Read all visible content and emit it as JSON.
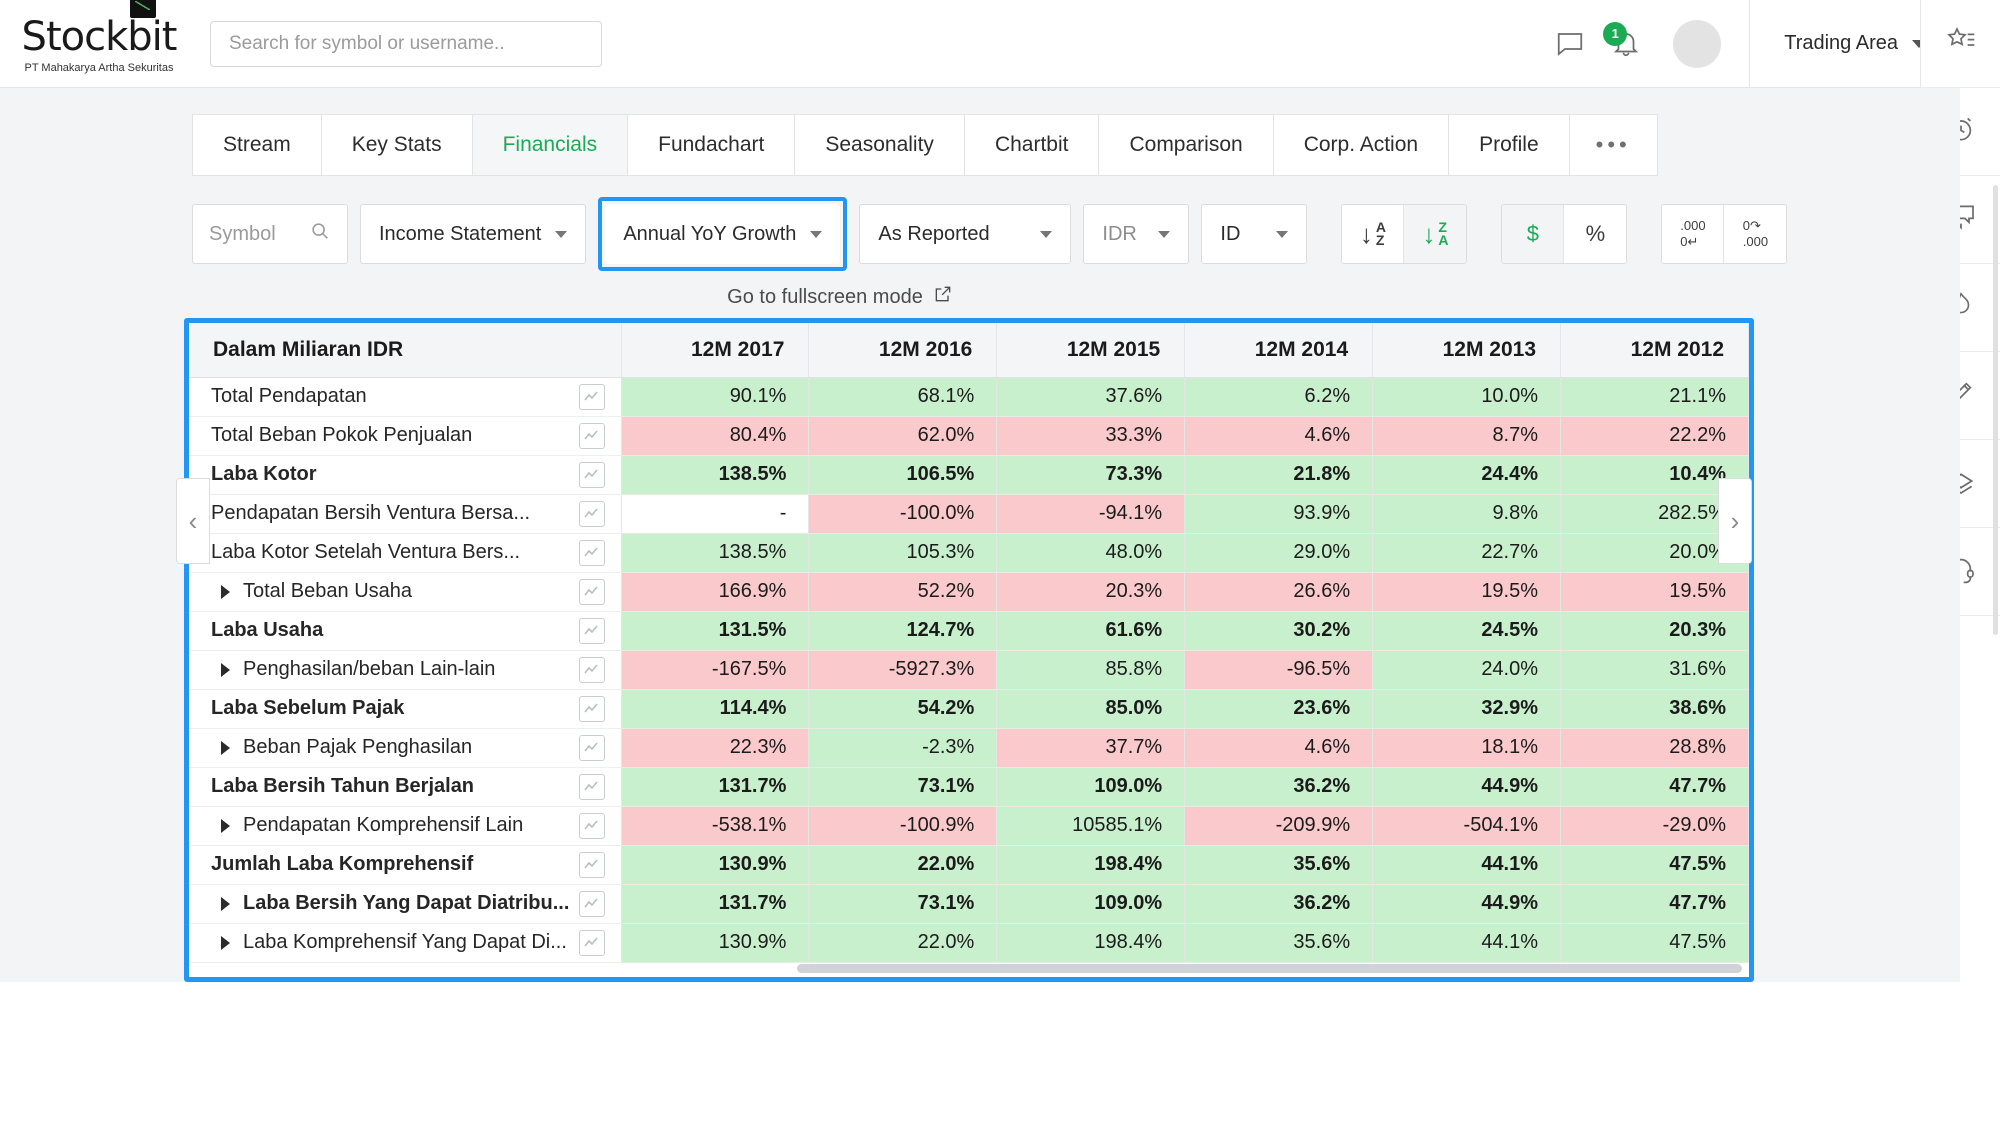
{
  "header": {
    "logo_text": "Stockbit",
    "logo_subtitle": "PT Mahakarya Artha Sekuritas",
    "search_placeholder": "Search for symbol or username..",
    "search_value": "",
    "notification_badge": "1",
    "trading_area_label": "Trading Area",
    "icons": [
      "chat-icon",
      "bell-icon",
      "avatar"
    ]
  },
  "tabs": [
    {
      "label": "Stream",
      "active": false
    },
    {
      "label": "Key Stats",
      "active": false
    },
    {
      "label": "Financials",
      "active": true
    },
    {
      "label": "Fundachart",
      "active": false
    },
    {
      "label": "Seasonality",
      "active": false
    },
    {
      "label": "Chartbit",
      "active": false
    },
    {
      "label": "Comparison",
      "active": false
    },
    {
      "label": "Corp. Action",
      "active": false
    },
    {
      "label": "Profile",
      "active": false
    },
    {
      "label": "•••",
      "active": false
    }
  ],
  "toolbar": {
    "symbol_placeholder": "Symbol",
    "symbol_value": "",
    "statement_type": "Income Statement",
    "growth_mode": "Annual YoY Growth",
    "reporting": "As Reported",
    "currency": "IDR",
    "language": "ID",
    "sort_asc_label": "A\nZ",
    "sort_desc_label": "Z\nA",
    "currency_unit_label": "$",
    "percent_label": "%",
    "decimal_more_label": ".000 / 0↵",
    "decimal_less_label": "0↱ / .000",
    "fullscreen_label": "Go to fullscreen mode"
  },
  "table": {
    "unit_header": "Dalam Miliaran IDR",
    "columns": [
      "12M 2017",
      "12M 2016",
      "12M 2015",
      "12M 2014",
      "12M 2013",
      "12M 2012"
    ],
    "rows": [
      {
        "label": "Total Pendapatan",
        "bold": false,
        "expandable": false,
        "values": [
          "90.1%",
          "68.1%",
          "37.6%",
          "6.2%",
          "10.0%",
          "21.1%"
        ],
        "tone": [
          "pos",
          "pos",
          "pos",
          "pos",
          "pos",
          "pos"
        ]
      },
      {
        "label": "Total Beban Pokok Penjualan",
        "bold": false,
        "expandable": false,
        "values": [
          "80.4%",
          "62.0%",
          "33.3%",
          "4.6%",
          "8.7%",
          "22.2%"
        ],
        "tone": [
          "neg",
          "neg",
          "neg",
          "neg",
          "neg",
          "neg"
        ]
      },
      {
        "label": "Laba Kotor",
        "bold": true,
        "expandable": false,
        "values": [
          "138.5%",
          "106.5%",
          "73.3%",
          "21.8%",
          "24.4%",
          "10.4%"
        ],
        "tone": [
          "pos",
          "pos",
          "pos",
          "pos",
          "pos",
          "pos"
        ]
      },
      {
        "label": "Pendapatan Bersih Ventura Bersa...",
        "bold": false,
        "expandable": false,
        "values": [
          "-",
          "-100.0%",
          "-94.1%",
          "93.9%",
          "9.8%",
          "282.5%"
        ],
        "tone": [
          "none",
          "neg",
          "neg",
          "pos",
          "pos",
          "pos"
        ]
      },
      {
        "label": "Laba Kotor Setelah Ventura Bers...",
        "bold": false,
        "expandable": false,
        "values": [
          "138.5%",
          "105.3%",
          "48.0%",
          "29.0%",
          "22.7%",
          "20.0%"
        ],
        "tone": [
          "pos",
          "pos",
          "pos",
          "pos",
          "pos",
          "pos"
        ]
      },
      {
        "label": "Total Beban Usaha",
        "bold": false,
        "expandable": true,
        "values": [
          "166.9%",
          "52.2%",
          "20.3%",
          "26.6%",
          "19.5%",
          "19.5%"
        ],
        "tone": [
          "neg",
          "neg",
          "neg",
          "neg",
          "neg",
          "neg"
        ]
      },
      {
        "label": "Laba Usaha",
        "bold": true,
        "expandable": false,
        "values": [
          "131.5%",
          "124.7%",
          "61.6%",
          "30.2%",
          "24.5%",
          "20.3%"
        ],
        "tone": [
          "pos",
          "pos",
          "pos",
          "pos",
          "pos",
          "pos"
        ]
      },
      {
        "label": "Penghasilan/beban Lain-lain",
        "bold": false,
        "expandable": true,
        "values": [
          "-167.5%",
          "-5927.3%",
          "85.8%",
          "-96.5%",
          "24.0%",
          "31.6%"
        ],
        "tone": [
          "neg",
          "neg",
          "pos",
          "neg",
          "pos",
          "pos"
        ]
      },
      {
        "label": "Laba Sebelum Pajak",
        "bold": true,
        "expandable": false,
        "values": [
          "114.4%",
          "54.2%",
          "85.0%",
          "23.6%",
          "32.9%",
          "38.6%"
        ],
        "tone": [
          "pos",
          "pos",
          "pos",
          "pos",
          "pos",
          "pos"
        ]
      },
      {
        "label": "Beban Pajak Penghasilan",
        "bold": false,
        "expandable": true,
        "values": [
          "22.3%",
          "-2.3%",
          "37.7%",
          "4.6%",
          "18.1%",
          "28.8%"
        ],
        "tone": [
          "neg",
          "pos",
          "neg",
          "neg",
          "neg",
          "neg"
        ]
      },
      {
        "label": "Laba Bersih Tahun Berjalan",
        "bold": true,
        "expandable": false,
        "values": [
          "131.7%",
          "73.1%",
          "109.0%",
          "36.2%",
          "44.9%",
          "47.7%"
        ],
        "tone": [
          "pos",
          "pos",
          "pos",
          "pos",
          "pos",
          "pos"
        ]
      },
      {
        "label": "Pendapatan Komprehensif Lain",
        "bold": false,
        "expandable": true,
        "values": [
          "-538.1%",
          "-100.9%",
          "10585.1%",
          "-209.9%",
          "-504.1%",
          "-29.0%"
        ],
        "tone": [
          "neg",
          "neg",
          "pos",
          "neg",
          "neg",
          "neg"
        ]
      },
      {
        "label": "Jumlah Laba Komprehensif",
        "bold": true,
        "expandable": false,
        "values": [
          "130.9%",
          "22.0%",
          "198.4%",
          "35.6%",
          "44.1%",
          "47.5%"
        ],
        "tone": [
          "pos",
          "pos",
          "pos",
          "pos",
          "pos",
          "pos"
        ]
      },
      {
        "label": "Laba Bersih Yang Dapat Diatribu...",
        "bold": true,
        "expandable": true,
        "values": [
          "131.7%",
          "73.1%",
          "109.0%",
          "36.2%",
          "44.9%",
          "47.7%"
        ],
        "tone": [
          "pos",
          "pos",
          "pos",
          "pos",
          "pos",
          "pos"
        ]
      },
      {
        "label": "Laba Komprehensif Yang Dapat Di...",
        "bold": false,
        "expandable": true,
        "values": [
          "130.9%",
          "22.0%",
          "198.4%",
          "35.6%",
          "44.1%",
          "47.5%"
        ],
        "tone": [
          "pos",
          "pos",
          "pos",
          "pos",
          "pos",
          "pos"
        ]
      }
    ]
  },
  "rail": {
    "items": [
      {
        "icon": "watchlist-star-icon"
      },
      {
        "icon": "alarm-clock-icon"
      },
      {
        "icon": "chat-bubbles-icon"
      },
      {
        "icon": "fire-trending-icon"
      },
      {
        "icon": "pencil-icon"
      },
      {
        "icon": "inbox-stack-icon"
      },
      {
        "icon": "headset-support-icon"
      }
    ]
  },
  "colors": {
    "accent_blue": "#2196f3",
    "green": "#1bab55",
    "positive_bg": "#c8f0cd",
    "negative_bg": "#fac9cb"
  }
}
